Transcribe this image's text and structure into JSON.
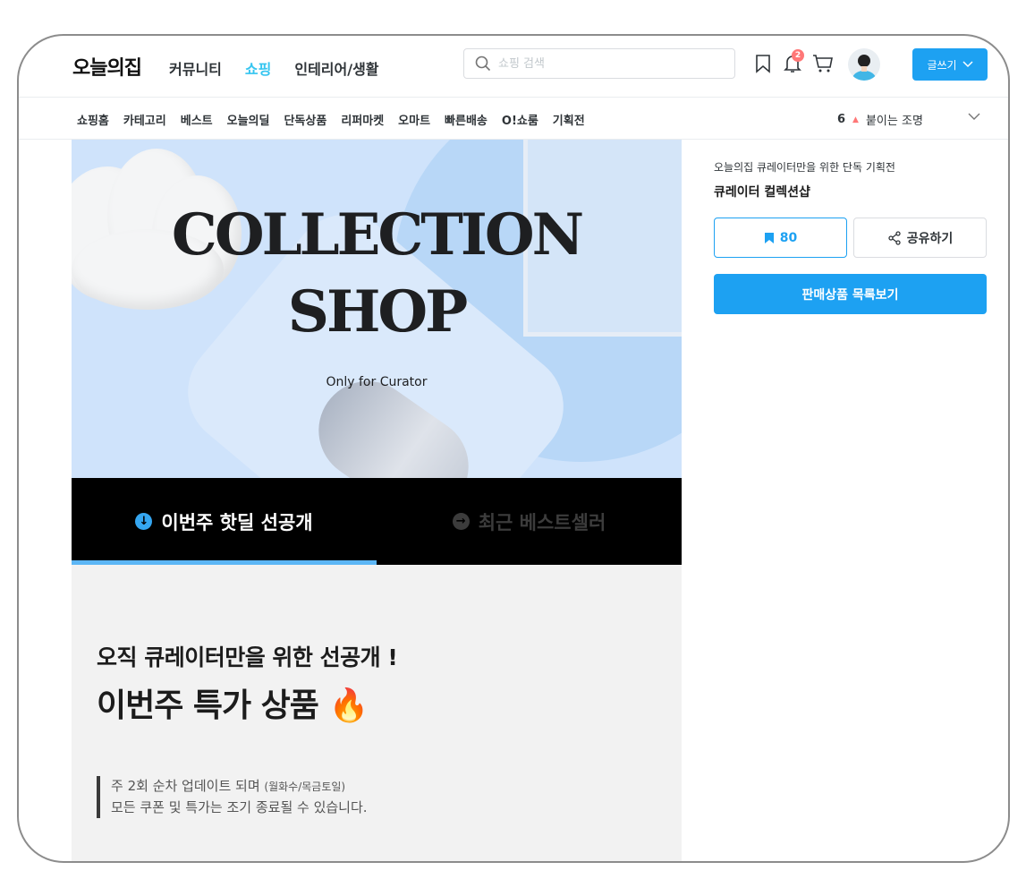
{
  "header": {
    "logo": "오늘의집",
    "nav": [
      "커뮤니티",
      "쇼핑",
      "인테리어/생활"
    ],
    "search_placeholder": "쇼핑 검색",
    "notification_count": "2",
    "write_label": "글쓰기"
  },
  "subnav": {
    "items": [
      "쇼핑홈",
      "카테고리",
      "베스트",
      "오늘의딜",
      "단독상품",
      "리퍼마켓",
      "오마트",
      "빠른배송",
      "O!쇼룸",
      "기획전"
    ],
    "ranking": {
      "rank": "6",
      "keyword": "붙이는 조명"
    }
  },
  "banner": {
    "title_line1": "COLLECTION",
    "title_line2": "SHOP",
    "subtitle": "Only for Curator"
  },
  "tabs": [
    {
      "label": "이번주 핫딜 선공개",
      "active": true
    },
    {
      "label": "최근 베스트셀러",
      "active": false
    }
  ],
  "content": {
    "line1": "오직 큐레이터만을 위한 선공개 !",
    "line2": "이번주 특가 상품",
    "emoji": "🔥",
    "note_line1_main": "주 2회 순차 업데이트 되며",
    "note_line1_small": "(월화수/목금토일)",
    "note_line2": "모든 쿠폰 및 특가는 조기 종료될 수 있습니다."
  },
  "side": {
    "subtitle": "오늘의집 큐레이터만을 위한 단독 기획전",
    "title": "큐레이터 컬렉션샵",
    "scrap_count": "80",
    "share_label": "공유하기",
    "list_button": "판매상품 목록보기"
  },
  "colors": {
    "accent": "#1da1f2",
    "active_nav": "#35c5f0",
    "banner_bg": "#cfe3fb",
    "tab_bg": "#000000",
    "tab_active_underline": "#5cb6f5",
    "badge": "#ff7777"
  }
}
